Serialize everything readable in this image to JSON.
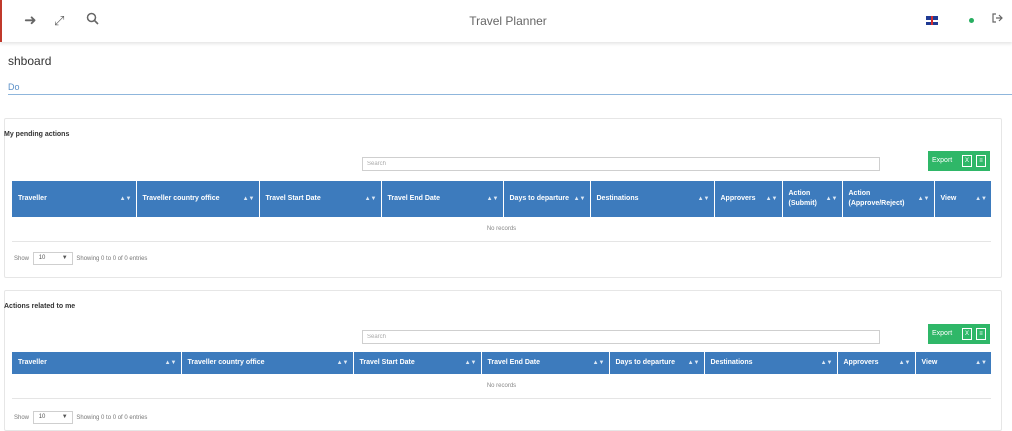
{
  "app": {
    "title": "Travel Planner"
  },
  "header_icons": [
    "forward-arrow-icon",
    "expand-icon",
    "search-icon",
    "uk-flag-icon",
    "status-dot-icon",
    "logout-icon"
  ],
  "breadcrumb": "shboard",
  "tab": "Do",
  "colors": {
    "header_blue": "#3d7bbd",
    "export_green": "#2fb768",
    "accent_red": "#c0392b"
  },
  "pending": {
    "title": "My pending actions",
    "search_placeholder": "Search",
    "export_label": "Export",
    "columns": [
      "Traveller",
      "Traveller country office",
      "Travel Start Date",
      "Travel End Date",
      "Days to departure",
      "Destinations",
      "Approvers",
      "Action (Submit)",
      "Action (Approve/Reject)",
      "View"
    ],
    "empty_text": "No records",
    "length": {
      "show": "Show",
      "value": "10",
      "info": "Showing 0 to 0 of 0 entries"
    }
  },
  "related": {
    "title": "Actions related to me",
    "search_placeholder": "Search",
    "export_label": "Export",
    "columns": [
      "Traveller",
      "Traveller country office",
      "Travel Start Date",
      "Travel End Date",
      "Days to departure",
      "Destinations",
      "Approvers",
      "View"
    ],
    "empty_text": "No records",
    "length": {
      "show": "Show",
      "value": "10",
      "info": "Showing 0 to 0 of 0 entries"
    }
  }
}
